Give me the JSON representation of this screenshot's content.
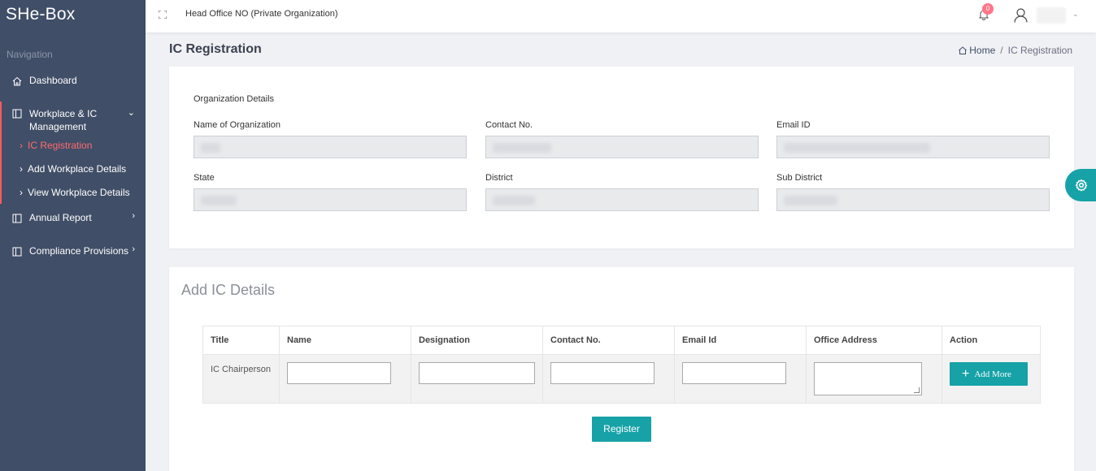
{
  "app": {
    "brand": "SHe-Box"
  },
  "sidebar": {
    "heading": "Navigation",
    "items": [
      {
        "label": "Dashboard",
        "icon": "home-icon"
      },
      {
        "label": "Workplace & IC Management",
        "icon": "panel-icon",
        "children": [
          {
            "label": "IC Registration",
            "active": true
          },
          {
            "label": "Add Workplace Details"
          },
          {
            "label": "View Workplace Details"
          }
        ]
      },
      {
        "label": "Annual Report",
        "icon": "panel-icon"
      },
      {
        "label": "Compliance Provisions",
        "icon": "panel-icon"
      }
    ]
  },
  "topbar": {
    "org_title": "Head Office NO (Private Organization)",
    "notification_count": "0"
  },
  "page": {
    "title": "IC Registration",
    "breadcrumb": {
      "home": "Home",
      "current": "IC Registration"
    }
  },
  "org_details": {
    "section_label": "Organization Details",
    "fields": {
      "name": {
        "label": "Name of Organization"
      },
      "contact": {
        "label": "Contact No."
      },
      "email": {
        "label": "Email ID"
      },
      "state": {
        "label": "State"
      },
      "district": {
        "label": "District"
      },
      "sub_district": {
        "label": "Sub District"
      }
    }
  },
  "ic_details": {
    "title": "Add IC Details",
    "columns": [
      "Title",
      "Name",
      "Designation",
      "Contact No.",
      "Email Id",
      "Office Address",
      "Action"
    ],
    "rows": [
      {
        "title": "IC Chairperson"
      }
    ],
    "add_more_label": "Add More",
    "register_label": "Register"
  },
  "colors": {
    "sidebar_bg": "#404e67",
    "accent_teal": "#16a2a7",
    "active_red": "#ff5b60",
    "badge": "#ff7588"
  }
}
